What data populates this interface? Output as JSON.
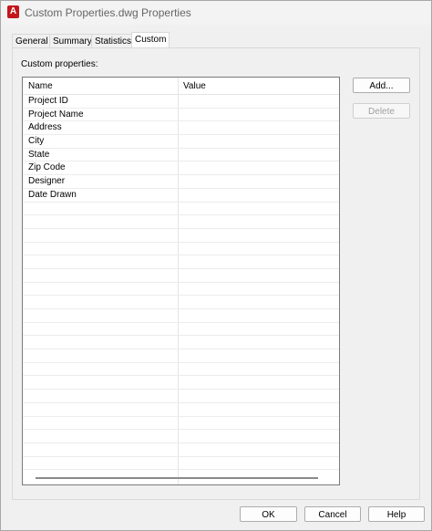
{
  "window": {
    "title": "Custom Properties.dwg Properties",
    "app_icon_letter": "A"
  },
  "tabs": [
    {
      "label": "General",
      "active": false
    },
    {
      "label": "Summary",
      "active": false
    },
    {
      "label": "Statistics",
      "active": false
    },
    {
      "label": "Custom",
      "active": true
    }
  ],
  "custom": {
    "group_label": "Custom properties:",
    "columns": {
      "name": "Name",
      "value": "Value"
    },
    "rows": [
      {
        "name": "Project ID",
        "value": ""
      },
      {
        "name": "Project Name",
        "value": ""
      },
      {
        "name": "Address",
        "value": ""
      },
      {
        "name": "City",
        "value": ""
      },
      {
        "name": "State",
        "value": ""
      },
      {
        "name": "Zip Code",
        "value": ""
      },
      {
        "name": "Designer",
        "value": ""
      },
      {
        "name": "Date Drawn",
        "value": ""
      }
    ],
    "add_label": "Add...",
    "delete_label": "Delete"
  },
  "footer": {
    "ok_label": "OK",
    "cancel_label": "Cancel",
    "help_label": "Help"
  },
  "colors": {
    "app_icon": "#c4161c",
    "dialog_bg": "#f0f0f0"
  }
}
